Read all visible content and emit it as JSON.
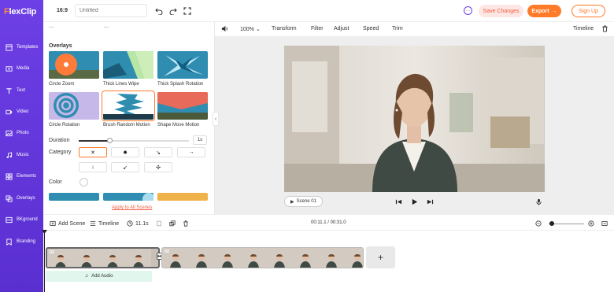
{
  "app": {
    "logo": "FlexClip"
  },
  "sidebar": {
    "items": [
      {
        "label": "Templates",
        "icon": "templates-icon"
      },
      {
        "label": "Media",
        "icon": "media-icon"
      },
      {
        "label": "Text",
        "icon": "text-icon"
      },
      {
        "label": "Video",
        "icon": "video-icon"
      },
      {
        "label": "Photo",
        "icon": "photo-icon"
      },
      {
        "label": "Music",
        "icon": "music-icon"
      },
      {
        "label": "Elements",
        "icon": "elements-icon"
      },
      {
        "label": "Overlays",
        "icon": "overlays-icon"
      },
      {
        "label": "BKground",
        "icon": "background-icon"
      },
      {
        "label": "Branding",
        "icon": "branding-icon"
      }
    ]
  },
  "topbar": {
    "ratio": "16:9",
    "title_placeholder": "Untitled",
    "save_label": "Save Changes",
    "export_label": "Export",
    "signup_label": "Sign Up"
  },
  "panel": {
    "section_title": "Overlays",
    "overlays": [
      {
        "label": "Circle Zoom"
      },
      {
        "label": "Thick Lines Wipe"
      },
      {
        "label": "Thick Splash Rotation"
      },
      {
        "label": "Circle Rotation"
      },
      {
        "label": "Brush Random Motion",
        "selected": true
      },
      {
        "label": "Shape Move Motion"
      }
    ],
    "duration_label": "Duration",
    "duration_value": "1s",
    "duration_fraction": 0.26,
    "category_label": "Category",
    "categories": [
      "✕",
      "✸",
      "↘",
      "→",
      "↓",
      "↙",
      "✣"
    ],
    "color_label": "Color",
    "apply_label": "Apply to All Scenes"
  },
  "toolbar": {
    "volume_icon": "volume-icon",
    "zoom": "100%",
    "items": [
      "Transform",
      "Filter",
      "Adjust",
      "Speed",
      "Trim"
    ],
    "timeline_label": "Timeline"
  },
  "preview": {
    "scene_label": "Scene 01"
  },
  "timeline": {
    "add_scene": "Add Scene",
    "timeline_label": "Timeline",
    "duration": "11.1s",
    "time_readout": "00:11.1 / 00:31.0",
    "clips": [
      {
        "number": "01",
        "selected": true
      },
      {
        "number": "02",
        "selected": false
      }
    ],
    "add_audio": "Add Audio"
  },
  "colors": {
    "sidebar": "#6d3fe6",
    "accent": "#ff7a29",
    "save_bg": "#fde7e4",
    "audio_bg": "#e1f6ec"
  }
}
